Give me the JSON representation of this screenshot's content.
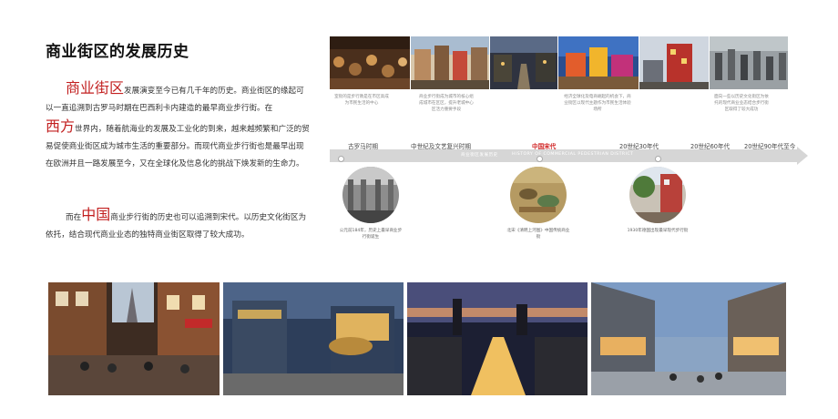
{
  "title": "商业街区的发展历史",
  "para1": {
    "keyword1": "商业街区",
    "text1": "发展演变至今已有几千年的历史。商业街区的缘起可以一直追溯到古罗马时期在巴西利卡内建造的最早商业步行街。在",
    "keyword2": "西方",
    "text2": "世界内，随着航海业的发展及工业化的到来，越来越频繁和广泛的贸易促使商业街区成为城市生活的重要部分。而现代商业步行街也是最早出现在欧洲并且一路发展至今，又在全球化及信息化的挑战下焕发新的生命力。"
  },
  "para2": {
    "prefix": "而在",
    "keyword": "中国",
    "text": "商业步行街的历史也可以追溯到宋代。以历史文化街区为依托，结合现代商业业态的独特商业街区取得了较大成功。"
  },
  "top_captions": [
    "室街的是步行教是在市区高成为市民生活的中心",
    "商业步行街成为城市的核心组成城市在区区，提升老城中心区活力重要手段",
    "经济全球化及电商崛起的机会下，商业街区以现代主题作为市民生活体验场所",
    "面向一些以历史文化街区为依托的现代商业业态结合步行街区取得了较大成功"
  ],
  "timeline": {
    "eras": [
      "古罗马时期",
      "中世纪及文艺复兴时期",
      "中国宋代",
      "20世纪30年代",
      "20世纪60年代",
      "20世纪90年代至今"
    ],
    "active_era": "中国宋代",
    "axis_label_cn": "商业街区发展历史",
    "axis_label_en": "HISTORY OF COMMERCIAL PEDESTRIAN DISTRICT"
  },
  "circle_captions": [
    "公元前184年，历史上最早商业步行街诞生",
    "北宋《清明上河图》中国传统商业街",
    "1930年德国出现最早现代步行街"
  ],
  "colors": {
    "accent": "#c21f1f",
    "axis": "#d6d6d6"
  }
}
